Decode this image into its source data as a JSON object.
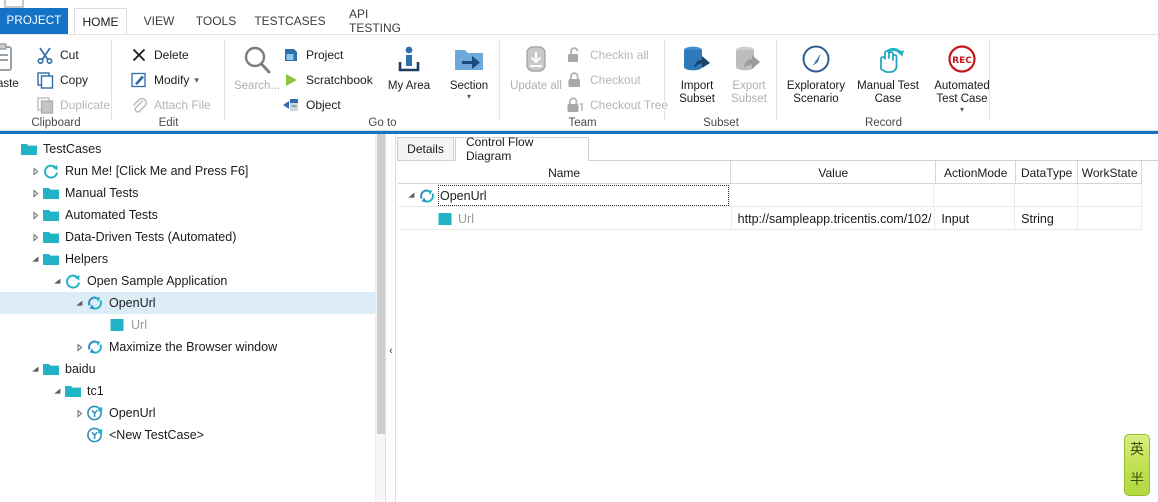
{
  "app": {
    "accent_color": "#1473c6",
    "teal": "#21b4c6"
  },
  "ribbon": {
    "project_button": "PROJECT",
    "tabs": [
      {
        "label": "HOME",
        "active": true
      },
      {
        "label": "VIEW",
        "active": false
      },
      {
        "label": "TOOLS",
        "active": false
      },
      {
        "label": "TESTCASES",
        "active": false
      },
      {
        "label": "API TESTING",
        "active": false
      }
    ],
    "groups": [
      {
        "name": "Clipboard",
        "big": [
          {
            "label": "Paste",
            "icon": "paste-icon",
            "enabled": true
          }
        ],
        "small": [
          {
            "label": "Cut",
            "icon": "cut-icon",
            "enabled": true
          },
          {
            "label": "Copy",
            "icon": "copy-icon",
            "enabled": true
          },
          {
            "label": "Duplicate",
            "icon": "duplicate-icon",
            "enabled": false
          }
        ]
      },
      {
        "name": "Edit",
        "small": [
          {
            "label": "Delete",
            "icon": "delete-x-icon",
            "enabled": true
          },
          {
            "label": "Modify",
            "icon": "pencil-icon",
            "enabled": true,
            "caret": true
          },
          {
            "label": "Attach File",
            "icon": "paperclip-icon",
            "enabled": false
          }
        ]
      },
      {
        "name": "Go to",
        "big": [
          {
            "label": "Search...",
            "icon": "magnifier-icon",
            "enabled": false
          },
          {
            "label": "My Area",
            "icon": "person-icon",
            "enabled": true
          }
        ],
        "small": [
          {
            "label": "Project",
            "icon": "project-icon",
            "enabled": true
          },
          {
            "label": "Scratchbook",
            "icon": "play-triangle-icon",
            "enabled": true
          },
          {
            "label": "Object",
            "icon": "object-icon",
            "enabled": true
          }
        ],
        "big2": [
          {
            "label": "Section",
            "icon": "section-arrow-icon",
            "enabled": true,
            "caret": true
          }
        ]
      },
      {
        "name": "Team",
        "big": [
          {
            "label": "Update all",
            "icon": "update-all-icon",
            "enabled": false
          }
        ],
        "small": [
          {
            "label": "Checkin all",
            "icon": "unlock-icon",
            "enabled": false
          },
          {
            "label": "Checkout",
            "icon": "lock-icon",
            "enabled": false
          },
          {
            "label": "Checkout Tree",
            "icon": "lock-tree-icon",
            "enabled": false
          }
        ]
      },
      {
        "name": "Subset",
        "big": [
          {
            "label": "Import Subset",
            "icon": "import-subset-icon",
            "enabled": true
          },
          {
            "label": "Export Subset",
            "icon": "export-subset-icon",
            "enabled": false
          }
        ]
      },
      {
        "name": "Record",
        "big": [
          {
            "label": "Exploratory Scenario",
            "icon": "compass-pen-icon",
            "enabled": true
          },
          {
            "label": "Manual Test Case",
            "icon": "hand-refresh-icon",
            "enabled": true
          },
          {
            "label": "Automated Test Case",
            "icon": "rec-icon",
            "enabled": true,
            "caret": true
          }
        ]
      }
    ]
  },
  "tree": {
    "nodes": [
      {
        "label": "TestCases",
        "depth": 0,
        "icon": "folder-icon",
        "expander": "none",
        "selected": false,
        "ghost": false
      },
      {
        "label": "Run Me! [Click Me and Press F6]",
        "depth": 1,
        "icon": "refresh-icon",
        "expander": "collapsed",
        "selected": false,
        "ghost": false
      },
      {
        "label": "Manual Tests",
        "depth": 1,
        "icon": "folder-icon",
        "expander": "collapsed",
        "selected": false,
        "ghost": false
      },
      {
        "label": "Automated Tests",
        "depth": 1,
        "icon": "folder-icon",
        "expander": "collapsed",
        "selected": false,
        "ghost": false
      },
      {
        "label": "Data-Driven Tests (Automated)",
        "depth": 1,
        "icon": "folder-icon",
        "expander": "collapsed",
        "selected": false,
        "ghost": false
      },
      {
        "label": "Helpers",
        "depth": 1,
        "icon": "folder-icon",
        "expander": "expanded",
        "selected": false,
        "ghost": false
      },
      {
        "label": "Open Sample Application",
        "depth": 2,
        "icon": "refresh-icon",
        "expander": "expanded",
        "selected": false,
        "ghost": false
      },
      {
        "label": "OpenUrl",
        "depth": 3,
        "icon": "refresh2-icon",
        "expander": "expanded",
        "selected": true,
        "ghost": false
      },
      {
        "label": "Url",
        "depth": 4,
        "icon": "square-icon",
        "expander": "none",
        "selected": false,
        "ghost": true
      },
      {
        "label": "Maximize the Browser window",
        "depth": 3,
        "icon": "refresh2-icon",
        "expander": "collapsed",
        "selected": false,
        "ghost": false
      },
      {
        "label": "baidu",
        "depth": 1,
        "icon": "folder-icon",
        "expander": "expanded",
        "selected": false,
        "ghost": false
      },
      {
        "label": "tc1",
        "depth": 2,
        "icon": "folder-icon",
        "expander": "expanded",
        "selected": false,
        "ghost": false
      },
      {
        "label": "OpenUrl",
        "depth": 3,
        "icon": "testcase-icon",
        "expander": "collapsed",
        "selected": false,
        "ghost": false
      },
      {
        "label": "<New TestCase>",
        "depth": 3,
        "icon": "testcase-icon",
        "expander": "none",
        "selected": false,
        "ghost": false
      }
    ]
  },
  "details": {
    "tabs": [
      {
        "label": "Details",
        "active": false
      },
      {
        "label": "Control Flow Diagram",
        "active": true
      }
    ],
    "columns": [
      "Name",
      "Value",
      "ActionMode",
      "DataType",
      "WorkState"
    ],
    "rows": [
      {
        "name": "OpenUrl",
        "value": "",
        "action_mode": "",
        "data_type": "",
        "work_state": "",
        "icon": "refresh2-icon",
        "indent": 0,
        "expander": "expanded",
        "focused": true,
        "gray_name": false
      },
      {
        "name": "Url",
        "value": "http://sampleapp.tricentis.com/102/",
        "action_mode": "Input",
        "data_type": "String",
        "work_state": "",
        "icon": "square-icon",
        "indent": 1,
        "expander": "none",
        "focused": false,
        "gray_name": true
      }
    ]
  },
  "ime": {
    "mode_glyph": "英",
    "width_glyph": "半"
  }
}
